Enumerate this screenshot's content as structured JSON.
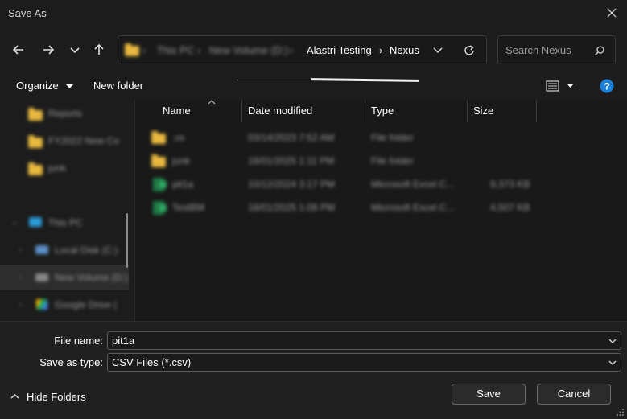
{
  "window": {
    "title": "Save As"
  },
  "breadcrumb": {
    "blurred_segments": [
      "This PC",
      "New Volume (D:)"
    ],
    "segments": [
      "Alastri Testing",
      "Nexus"
    ]
  },
  "search": {
    "placeholder": "Search Nexus"
  },
  "toolbar": {
    "organize_label": "Organize",
    "new_folder_label": "New folder"
  },
  "sidebar": {
    "items": [
      {
        "label": "Reports",
        "icon": "folder-icon"
      },
      {
        "label": "FY2022 New Co",
        "icon": "folder-icon"
      },
      {
        "label": "junk",
        "icon": "folder-icon"
      },
      {
        "label": "This PC",
        "icon": "computer-icon"
      },
      {
        "label": "Local Disk (C:)",
        "icon": "drive-icon"
      },
      {
        "label": "New Volume (D:)",
        "icon": "drive-icon"
      },
      {
        "label": "Google Drive (",
        "icon": "google-drive-icon"
      }
    ]
  },
  "file_list": {
    "columns": [
      "Name",
      "Date modified",
      "Type",
      "Size"
    ],
    "rows": [
      {
        "name": ".vs",
        "date": "03/14/2023 7:52 AM",
        "type": "File folder",
        "size": "",
        "icon": "folder-icon"
      },
      {
        "name": "junk",
        "date": "16/01/2025 1:11 PM",
        "type": "File folder",
        "size": "",
        "icon": "folder-icon"
      },
      {
        "name": "pit1a",
        "date": "10/12/2024 3:17 PM",
        "type": "Microsoft Excel C...",
        "size": "9,373 KB",
        "icon": "excel-icon"
      },
      {
        "name": "TestBM",
        "date": "16/01/2025 1:08 PM",
        "type": "Microsoft Excel C...",
        "size": "4,507 KB",
        "icon": "excel-icon"
      }
    ]
  },
  "form": {
    "file_name_label": "File name:",
    "file_name_value": "pit1a",
    "save_type_label": "Save as type:",
    "save_type_value": "CSV Files (*.csv)"
  },
  "footer": {
    "hide_folders_label": "Hide Folders",
    "save_label": "Save",
    "cancel_label": "Cancel"
  }
}
